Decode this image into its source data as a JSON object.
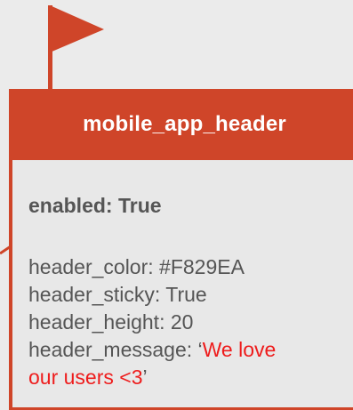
{
  "flag": {
    "color": "#cf4529"
  },
  "card": {
    "title": "mobile_app_header",
    "accent_color": "#cf4529",
    "enabled": {
      "label": "enabled:",
      "value": "True"
    },
    "config": {
      "header_color": "header_color: #F829EA",
      "header_sticky": "header_sticky: True",
      "header_height": "header_height: 20",
      "header_message_prefix": "header_message: ‘",
      "header_message_value_part1": "We love",
      "header_message_value_part2": "our users <3",
      "header_message_suffix": "’"
    }
  }
}
